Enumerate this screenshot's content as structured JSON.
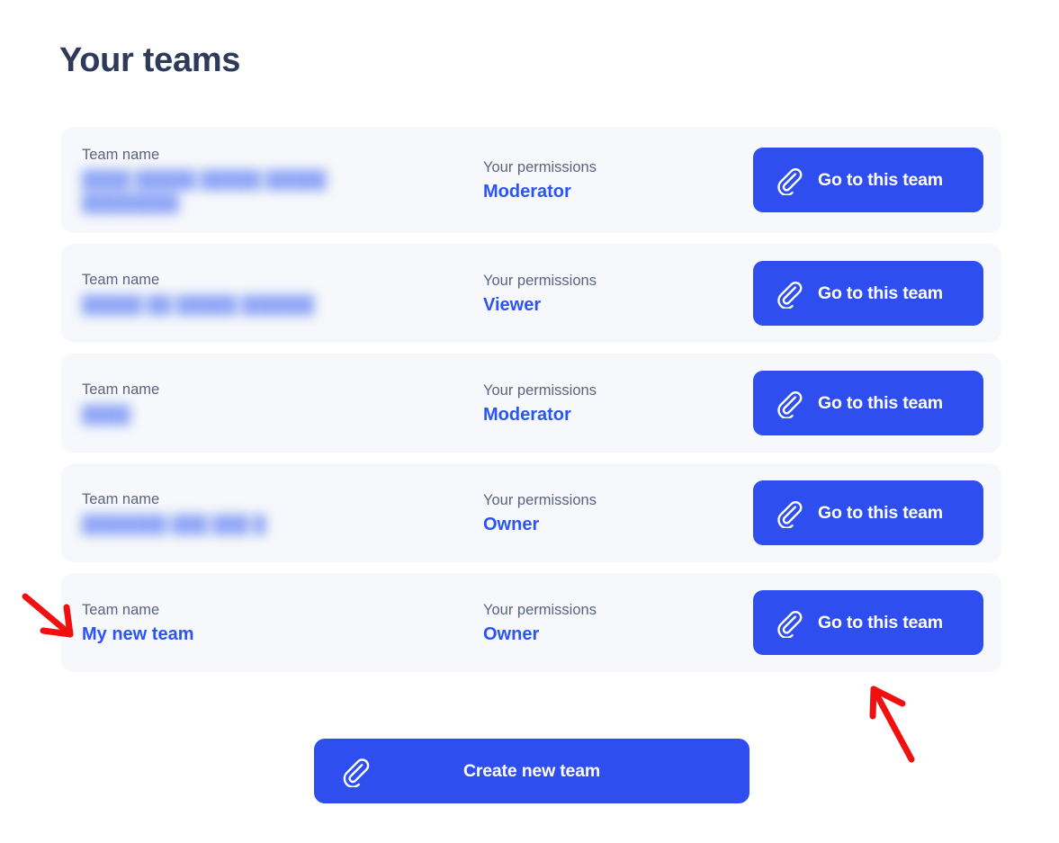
{
  "page": {
    "title": "Your teams"
  },
  "labels": {
    "team_name": "Team name",
    "your_permissions": "Your permissions"
  },
  "colors": {
    "accent_blue": "#2b54f5",
    "button_blue": "#2f4ef0",
    "card_background": "#f6f8fb",
    "title_navy": "#2e3a59",
    "label_grey": "#5a6480",
    "annotation_red": "#f01010"
  },
  "teams": [
    {
      "name_label": "Team name",
      "name_value": "████ █████ █████ █████ ████████",
      "name_redacted": true,
      "permissions_label": "Your permissions",
      "permissions_value": "Moderator",
      "action_label": "Go to this team",
      "action_icon": "paperclip-icon"
    },
    {
      "name_label": "Team name",
      "name_value": "█████ ██ █████ ██████",
      "name_redacted": true,
      "permissions_label": "Your permissions",
      "permissions_value": "Viewer",
      "action_label": "Go to this team",
      "action_icon": "paperclip-icon"
    },
    {
      "name_label": "Team name",
      "name_value": "████",
      "name_redacted": true,
      "permissions_label": "Your permissions",
      "permissions_value": "Moderator",
      "action_label": "Go to this team",
      "action_icon": "paperclip-icon"
    },
    {
      "name_label": "Team name",
      "name_value": "███████ ███ ███ █",
      "name_redacted": true,
      "permissions_label": "Your permissions",
      "permissions_value": "Owner",
      "action_label": "Go to this team",
      "action_icon": "paperclip-icon"
    },
    {
      "name_label": "Team name",
      "name_value": "My new team",
      "name_redacted": false,
      "permissions_label": "Your permissions",
      "permissions_value": "Owner",
      "action_label": "Go to this team",
      "action_icon": "paperclip-icon"
    }
  ],
  "create_button": {
    "label": "Create new team",
    "icon": "paperclip-icon"
  },
  "annotations": [
    {
      "name": "arrow-to-new-team-row",
      "direction": "down-right",
      "color": "#f01010"
    },
    {
      "name": "arrow-to-go-to-team-button",
      "direction": "up-left",
      "color": "#f01010"
    }
  ]
}
